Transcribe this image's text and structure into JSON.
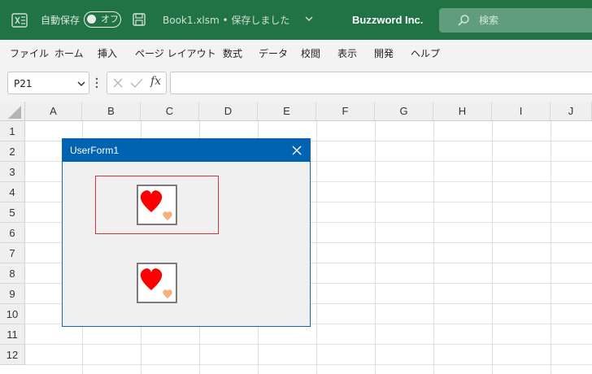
{
  "titlebar": {
    "autosave_label": "自動保存",
    "toggle_label": "オフ",
    "filename": "Book1.xlsm • 保存しました",
    "company": "Buzzword Inc.",
    "search_placeholder": "検索"
  },
  "menu": {
    "items": [
      "ファイル",
      "ホーム",
      "挿入",
      "ページ レイアウト",
      "数式",
      "データ",
      "校閲",
      "表示",
      "開発",
      "ヘルプ"
    ]
  },
  "formula_bar": {
    "name_box": "P21",
    "fx": "fx",
    "value": ""
  },
  "grid": {
    "columns": [
      "A",
      "B",
      "C",
      "D",
      "E",
      "F",
      "G",
      "H",
      "I",
      "J"
    ],
    "rows": [
      "1",
      "2",
      "3",
      "4",
      "5",
      "6",
      "7",
      "8",
      "9",
      "10",
      "11",
      "12"
    ]
  },
  "userform": {
    "title": "UserForm1"
  },
  "colors": {
    "excel_green": "#217346",
    "form_title_blue": "#0063b1",
    "frame_red": "#c8373f",
    "heart_big": "#ff0000",
    "heart_small": "#f7b07a"
  }
}
